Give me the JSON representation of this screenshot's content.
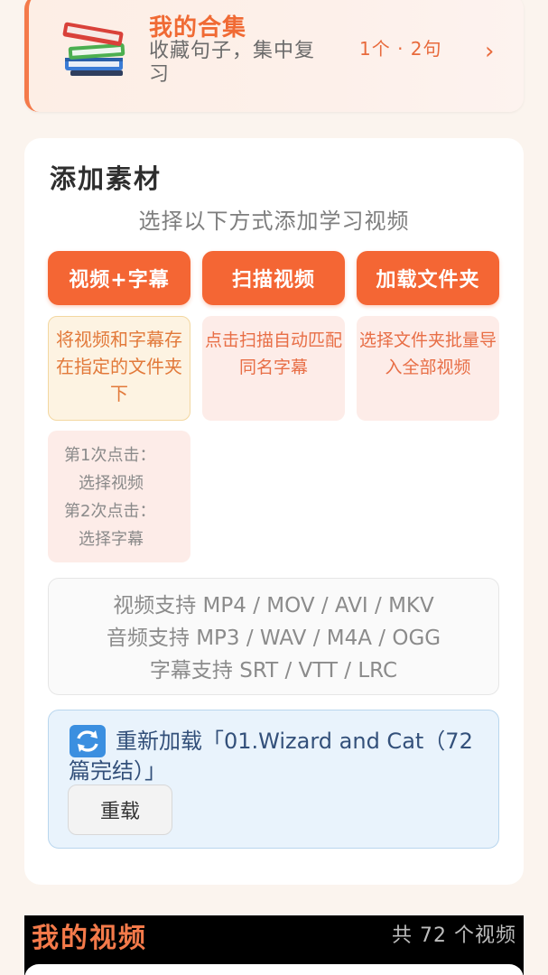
{
  "collection": {
    "title": "我的合集",
    "subtitle": "收藏句子，集中复习",
    "count": "1个 · 2句",
    "icon": "books-icon",
    "chevron": "›"
  },
  "add_material": {
    "title": "添加素材",
    "subtitle": "选择以下方式添加学习视频",
    "buttons": [
      {
        "label": "视频+字幕"
      },
      {
        "label": "扫描视频"
      },
      {
        "label": "加载文件夹"
      }
    ],
    "hints": [
      "将视频和字幕存在指定的文件夹下",
      "点击扫描自动匹配同名字幕",
      "选择文件夹批量导入全部视频"
    ],
    "steps": [
      "第1次点击：",
      "选择视频",
      "第2次点击：",
      "选择字幕"
    ],
    "formats": [
      "视频支持 MP4 / MOV / AVI / MKV",
      "音频支持 MP3 / WAV / M4A / OGG",
      "字幕支持 SRT / VTT / LRC"
    ],
    "reload": {
      "text": "重新加载「01.Wizard and Cat（72篇完结）」",
      "button": "重载",
      "icon": "reload-icon"
    }
  },
  "my_videos": {
    "title": "我的视频",
    "count": "共 72 个视频"
  },
  "colors": {
    "accent": "#f46634",
    "background": "#fbf4ee",
    "reload_bg": "#e9f3fc"
  }
}
